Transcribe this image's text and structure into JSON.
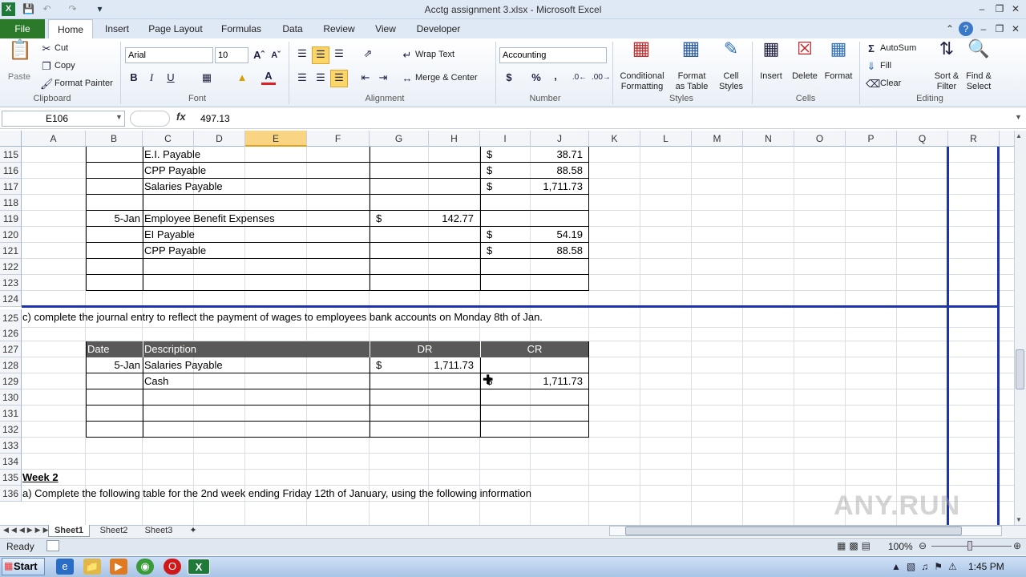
{
  "window": {
    "title": "Acctg assignment 3.xlsx - Microsoft Excel"
  },
  "tabs": [
    "File",
    "Home",
    "Insert",
    "Page Layout",
    "Formulas",
    "Data",
    "Review",
    "View",
    "Developer"
  ],
  "ribbon": {
    "clipboard": {
      "paste": "Paste",
      "cut": "Cut",
      "copy": "Copy",
      "format_painter": "Format Painter",
      "group": "Clipboard"
    },
    "font": {
      "name": "Arial",
      "size": "10",
      "group": "Font"
    },
    "alignment": {
      "wrap": "Wrap Text",
      "merge": "Merge & Center",
      "group": "Alignment"
    },
    "number": {
      "format": "Accounting",
      "currency": "$",
      "percent": "%",
      "comma": ",",
      "group": "Number"
    },
    "styles": {
      "conditional": "Conditional",
      "conditional2": "Formatting",
      "format_as": "Format",
      "format_as2": "as Table",
      "cell": "Cell",
      "cell2": "Styles",
      "group": "Styles"
    },
    "cells": {
      "insert": "Insert",
      "delete": "Delete",
      "format": "Format",
      "group": "Cells"
    },
    "editing": {
      "autosum": "AutoSum",
      "fill": "Fill",
      "clear": "Clear",
      "sort": "Sort &",
      "sort2": "Filter",
      "find": "Find &",
      "find2": "Select",
      "group": "Editing"
    }
  },
  "formula_bar": {
    "name_box": "E106",
    "fx": "fx",
    "formula": "497.13"
  },
  "columns": [
    "A",
    "B",
    "C",
    "D",
    "E",
    "F",
    "G",
    "H",
    "I",
    "J",
    "K",
    "L",
    "M",
    "N",
    "O",
    "P",
    "Q",
    "R"
  ],
  "rows": [
    "115",
    "116",
    "117",
    "118",
    "119",
    "120",
    "121",
    "122",
    "123",
    "124",
    "125",
    "126",
    "127",
    "128",
    "129",
    "130",
    "131",
    "132",
    "133",
    "134",
    "135",
    "136"
  ],
  "sheet": {
    "r115_desc": "E.I. Payable",
    "r115_cr_sym": "$",
    "r115_cr": "38.71",
    "r116_desc": "CPP Payable",
    "r116_cr_sym": "$",
    "r116_cr": "88.58",
    "r117_desc": "Salaries Payable",
    "r117_cr_sym": "$",
    "r117_cr": "1,711.73",
    "r119_date": "5-Jan",
    "r119_desc": "Employee Benefit Expenses",
    "r119_dr_sym": "$",
    "r119_dr": "142.77",
    "r120_desc": "EI Payable",
    "r120_cr_sym": "$",
    "r120_cr": "54.19",
    "r121_desc": "CPP Payable",
    "r121_cr_sym": "$",
    "r121_cr": "88.58",
    "r125_text": "c) complete the journal entry to reflect the payment of wages to employees bank accounts on Monday 8th of Jan.",
    "hdr_date": "Date",
    "hdr_desc": "Description",
    "hdr_dr": "DR",
    "hdr_cr": "CR",
    "r128_date": "5-Jan",
    "r128_desc": "Salaries Payable",
    "r128_dr_sym": "$",
    "r128_dr": "1,711.73",
    "r129_desc": "Cash",
    "r129_cr_sym": "$",
    "r129_cr": "1,711.73",
    "r135_text": "Week 2",
    "r136_text": "a) Complete the following table for the 2nd week ending Friday 12th of January, using the following information"
  },
  "sheet_tabs": [
    "Sheet1",
    "Sheet2",
    "Sheet3"
  ],
  "status": {
    "ready": "Ready",
    "zoom": "100%"
  },
  "taskbar": {
    "start": "Start",
    "time": "1:45 PM"
  },
  "watermark": "ANY.RUN"
}
